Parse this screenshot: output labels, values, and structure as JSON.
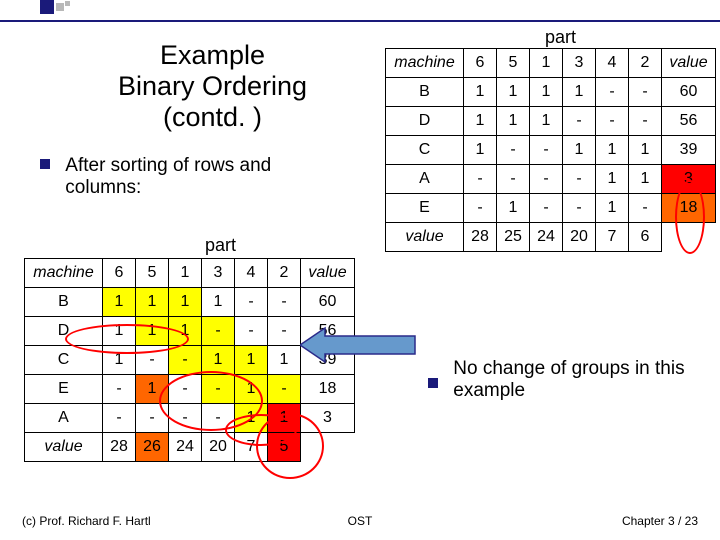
{
  "title": {
    "l1": "Example",
    "l2": "Binary Ordering",
    "l3": "(contd. )"
  },
  "bulletText": "After sorting of rows and\ncolumns:",
  "partLabel": "part",
  "machineHeader": "machine",
  "valueHeader": "value",
  "table1": {
    "header": [
      "6",
      "5",
      "1",
      "3",
      "4",
      "2"
    ],
    "rows": [
      {
        "m": "B",
        "cells": [
          "1",
          "1",
          "1",
          "1",
          "-",
          "-"
        ],
        "v": "60"
      },
      {
        "m": "D",
        "cells": [
          "1",
          "1",
          "1",
          "-",
          "-",
          "-"
        ],
        "v": "56"
      },
      {
        "m": "C",
        "cells": [
          "1",
          "-",
          "-",
          "1",
          "1",
          "1"
        ],
        "v": "39"
      },
      {
        "m": "A",
        "cells": [
          "-",
          "-",
          "-",
          "-",
          "1",
          "1"
        ],
        "v": "3",
        "vClass": "hl-r"
      },
      {
        "m": "E",
        "cells": [
          "-",
          "1",
          "-",
          "-",
          "1",
          "-"
        ],
        "v": "18",
        "vClass": "hl-o"
      }
    ],
    "footer": [
      "28",
      "25",
      "24",
      "20",
      "7",
      "6"
    ]
  },
  "table2": {
    "header": [
      "6",
      "5",
      "1",
      "3",
      "4",
      "2"
    ],
    "rows": [
      {
        "m": "B",
        "cells": [
          {
            "t": "1",
            "c": "hl-y"
          },
          {
            "t": "1",
            "c": "hl-y"
          },
          {
            "t": "1",
            "c": "hl-y"
          },
          {
            "t": "1",
            "c": ""
          },
          {
            "t": "-",
            "c": ""
          },
          {
            "t": "-",
            "c": ""
          }
        ],
        "v": "60"
      },
      {
        "m": "D",
        "cells": [
          {
            "t": "1",
            "c": ""
          },
          {
            "t": "1",
            "c": "hl-y"
          },
          {
            "t": "1",
            "c": "hl-y"
          },
          {
            "t": "-",
            "c": "hl-y"
          },
          {
            "t": "-",
            "c": ""
          },
          {
            "t": "-",
            "c": ""
          }
        ],
        "v": "56"
      },
      {
        "m": "C",
        "cells": [
          {
            "t": "1",
            "c": ""
          },
          {
            "t": "-",
            "c": ""
          },
          {
            "t": "-",
            "c": "hl-y"
          },
          {
            "t": "1",
            "c": "hl-y"
          },
          {
            "t": "1",
            "c": "hl-y"
          },
          {
            "t": "1",
            "c": ""
          }
        ],
        "v": "39"
      },
      {
        "m": "E",
        "cells": [
          {
            "t": "-",
            "c": ""
          },
          {
            "t": "1",
            "c": "hl-o"
          },
          {
            "t": "-",
            "c": ""
          },
          {
            "t": "-",
            "c": "hl-y"
          },
          {
            "t": "1",
            "c": "hl-y"
          },
          {
            "t": "-",
            "c": "hl-y"
          }
        ],
        "v": "18"
      },
      {
        "m": "A",
        "cells": [
          {
            "t": "-",
            "c": ""
          },
          {
            "t": "-",
            "c": ""
          },
          {
            "t": "-",
            "c": ""
          },
          {
            "t": "-",
            "c": ""
          },
          {
            "t": "1",
            "c": "hl-y"
          },
          {
            "t": "1",
            "c": "hl-r"
          }
        ],
        "v": "3"
      }
    ],
    "footer": [
      "28",
      "26",
      "24",
      "20",
      "7",
      "5"
    ],
    "footerClass": [
      "",
      "hl-o",
      "",
      "",
      "",
      "hl-r"
    ]
  },
  "sideNote": "No change of groups in this example",
  "footer": {
    "left": "(c) Prof. Richard F. Hartl",
    "center": "OST",
    "right": "Chapter 3 / 23",
    "pageOverlay": "23"
  }
}
